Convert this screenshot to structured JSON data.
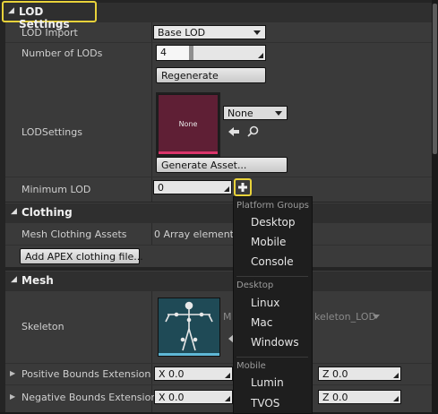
{
  "lod_section": {
    "title": "LOD Settings",
    "lod_import": {
      "label": "LOD Import",
      "value": "Base LOD"
    },
    "num_lods": {
      "label": "Number of LODs",
      "value": "4",
      "slider_fraction": 0.3
    },
    "regenerate_label": "Regenerate",
    "lod_settings": {
      "label": "LODSettings",
      "thumbnail_text": "None",
      "asset_value": "None"
    },
    "generate_asset_label": "Generate Asset...",
    "minimum_lod": {
      "label": "Minimum LOD",
      "value": "0"
    }
  },
  "clothing_section": {
    "title": "Clothing",
    "mesh_clothing_assets": {
      "label": "Mesh Clothing Assets",
      "value": "0 Array elements"
    },
    "add_apex_label": "Add APEX clothing file..."
  },
  "mesh_section": {
    "title": "Mesh",
    "skeleton": {
      "label": "Skeleton",
      "asset_prefix": "M",
      "asset_value": "keleton_LOD"
    },
    "positive_bounds": {
      "label": "Positive Bounds Extension",
      "x": "X  0.0",
      "z": "Z  0.0"
    },
    "negative_bounds": {
      "label": "Negative Bounds Extension",
      "x": "X  0.0",
      "z": "Z  0.0"
    }
  },
  "platform_menu": {
    "groups": [
      {
        "title": "Platform Groups",
        "items": [
          "Desktop",
          "Mobile",
          "Console"
        ]
      },
      {
        "title": "Desktop",
        "items": [
          "Linux",
          "Mac",
          "Windows"
        ]
      },
      {
        "title": "Mobile",
        "items": [
          "Lumin",
          "TVOS"
        ]
      }
    ]
  },
  "colors": {
    "highlight": "#e8d23a",
    "thumbnail": "#5f1f35",
    "accent": "#d9346a"
  }
}
